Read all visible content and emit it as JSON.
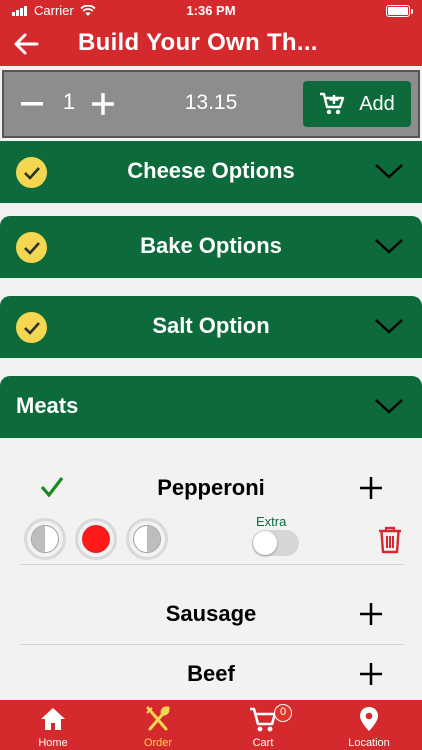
{
  "status_bar": {
    "carrier": "Carrier",
    "time": "1:36 PM"
  },
  "nav": {
    "title": "Build Your Own Th..."
  },
  "quantity_bar": {
    "minus_symbol": "−",
    "quantity": "1",
    "plus_symbol": "+",
    "price": "13.15",
    "add_label": "Add"
  },
  "sections": [
    {
      "label": "Cheese Options",
      "completed": true
    },
    {
      "label": "Bake Options",
      "completed": true
    },
    {
      "label": "Salt Option",
      "completed": true
    },
    {
      "label": "Meats",
      "completed": false,
      "expanded": true
    }
  ],
  "meats": {
    "items": [
      {
        "name": "Pepperoni",
        "selected": true,
        "portion": "whole",
        "extra_label": "Extra",
        "extra_on": false
      },
      {
        "name": "Sausage",
        "selected": false
      },
      {
        "name": "Beef",
        "selected": false
      }
    ]
  },
  "tab_bar": {
    "tabs": [
      {
        "label": "Home",
        "icon": "home-icon",
        "active": false
      },
      {
        "label": "Order",
        "icon": "utensils-icon",
        "active": true
      },
      {
        "label": "Cart",
        "icon": "cart-icon",
        "active": false,
        "badge": "0"
      },
      {
        "label": "Location",
        "icon": "location-pin-icon",
        "active": false
      }
    ]
  },
  "colors": {
    "brand_red": "#d42a2e",
    "brand_green": "#0d6a3b",
    "check_yellow": "#f3d750",
    "active_tab": "#f3d750",
    "portion_red": "#ff1a1a"
  }
}
